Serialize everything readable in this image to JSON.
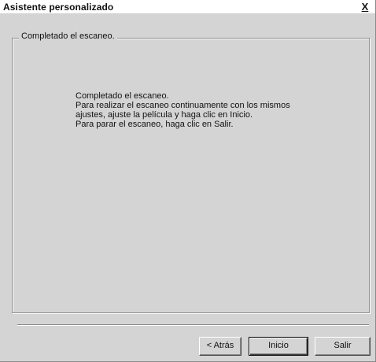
{
  "window": {
    "title": "Asistente personalizado",
    "close_label": "X"
  },
  "group": {
    "label": "Completado el escaneo."
  },
  "message": {
    "lines": [
      "Completado el escaneo.",
      "Para realizar el escaneo continuamente con los mismos",
      "ajustes, ajuste la película y haga clic en Inicio.",
      "Para parar el escaneo, haga clic en Salir."
    ]
  },
  "buttons": {
    "back_label": "< Atrás",
    "start_label": "Inicio",
    "exit_label": "Salir"
  }
}
